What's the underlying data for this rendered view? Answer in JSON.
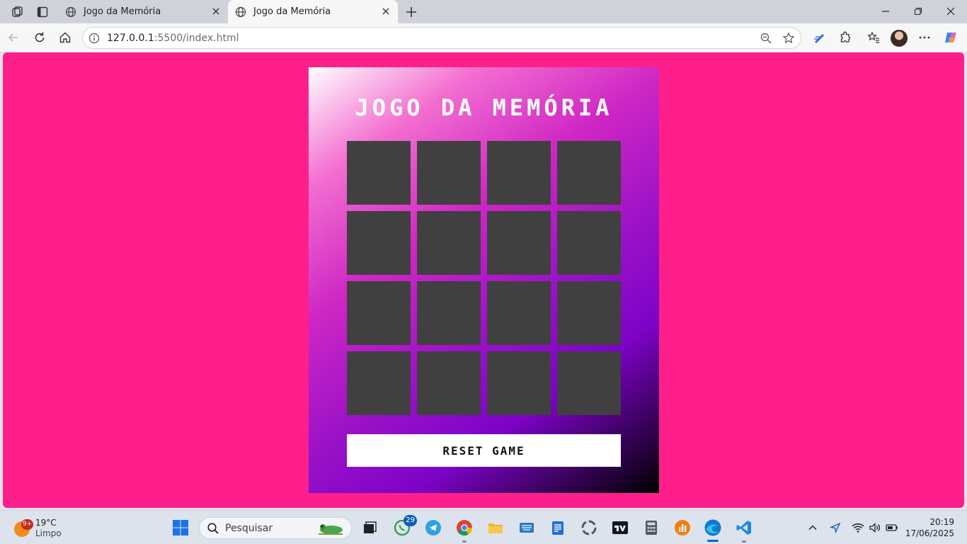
{
  "browser": {
    "tabs": [
      {
        "title": "Jogo da Memória",
        "active": false
      },
      {
        "title": "Jogo da Memória",
        "active": true
      }
    ],
    "address": {
      "host": "127.0.0.1",
      "rest": ":5500/index.html"
    }
  },
  "page": {
    "background_color": "#fe1f8b",
    "title": "JOGO DA MEMÓRIA",
    "card_color": "#404040",
    "cards": [
      "",
      "",
      "",
      "",
      "",
      "",
      "",
      "",
      "",
      "",
      "",
      "",
      "",
      "",
      "",
      ""
    ],
    "reset_label": "RESET GAME"
  },
  "taskbar": {
    "weather": {
      "badge": "9+",
      "temperature": "19°C",
      "condition": "Limpo"
    },
    "search_placeholder": "Pesquisar",
    "whatsapp_badge": "29",
    "time": "20:19",
    "date": "17/06/2025"
  }
}
